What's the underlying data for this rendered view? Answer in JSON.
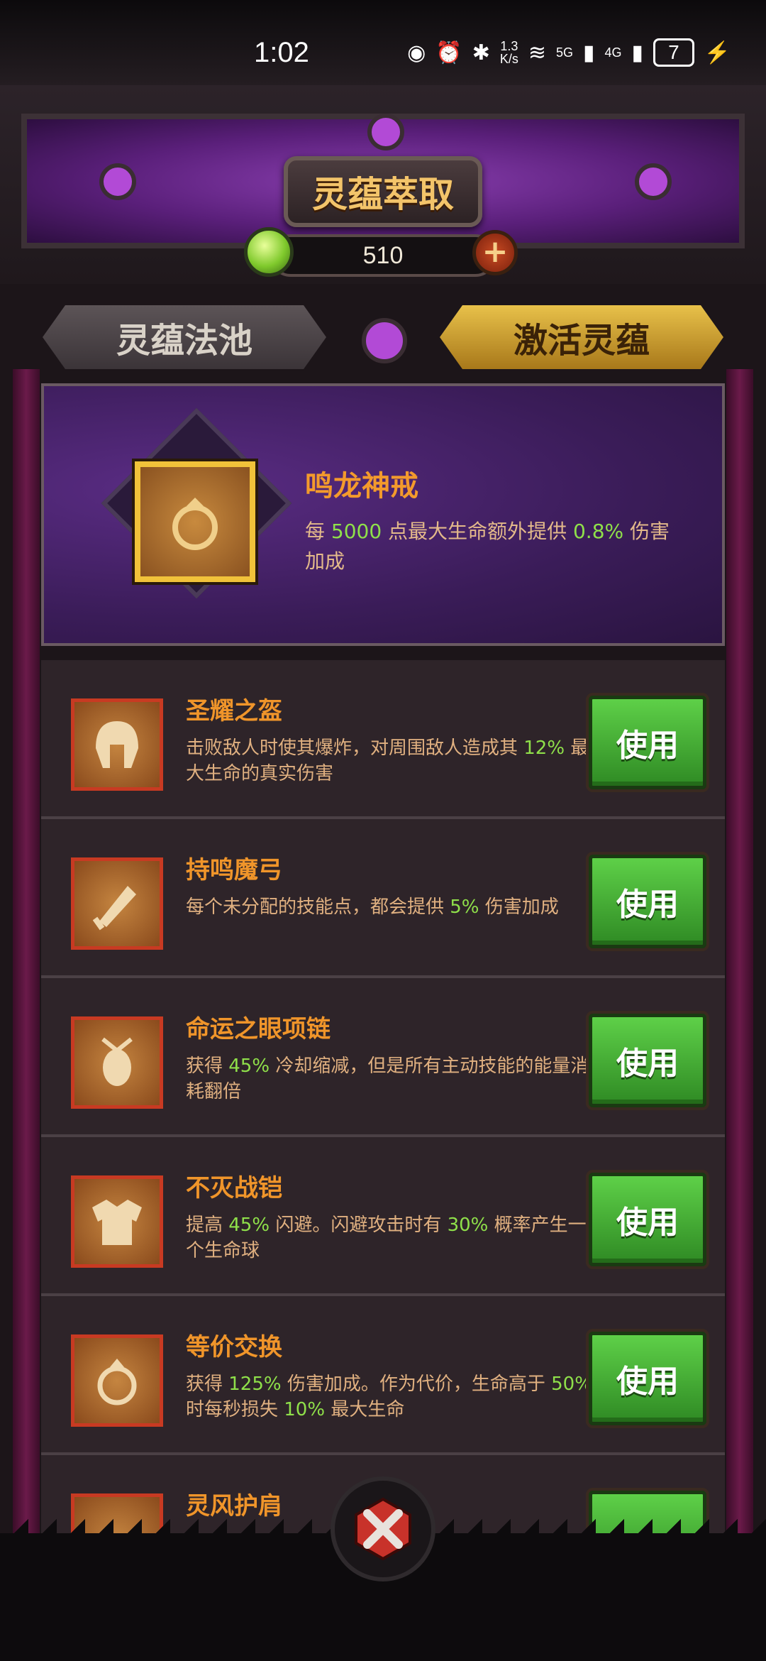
{
  "status_bar": {
    "time": "1:02",
    "net_speed": "1.3",
    "net_speed_unit": "K/s",
    "signal_5g": "5G",
    "signal_4g": "4G",
    "battery": "7"
  },
  "header": {
    "title": "灵蕴萃取",
    "currency_amount": "510"
  },
  "tabs": [
    {
      "label": "灵蕴法池",
      "active": false
    },
    {
      "label": "激活灵蕴",
      "active": true
    }
  ],
  "featured": {
    "name": "鸣龙神戒",
    "desc_parts": [
      "每 ",
      "5000",
      " 点最大生命额外提供 ",
      "0.8%",
      " 伤害加成"
    ]
  },
  "skills": [
    {
      "name": "圣耀之盔",
      "icon": "helmet-icon",
      "desc_parts": [
        "击败敌人时使其爆炸，对周围敌人造成其 ",
        "12%",
        " 最大生命的真实伤害"
      ],
      "button": "使用"
    },
    {
      "name": "持鸣魔弓",
      "icon": "bow-icon",
      "desc_parts": [
        "每个未分配的技能点，都会提供 ",
        "5%",
        " 伤害加成"
      ],
      "button": "使用"
    },
    {
      "name": "命运之眼项链",
      "icon": "amulet-icon",
      "desc_parts": [
        "获得 ",
        "45%",
        " 冷却缩减，但是所有主动技能的能量消耗翻倍"
      ],
      "button": "使用"
    },
    {
      "name": "不灭战铠",
      "icon": "armor-icon",
      "desc_parts": [
        "提高 ",
        "45%",
        " 闪避。闪避攻击时有 ",
        "30%",
        " 概率产生一个生命球"
      ],
      "button": "使用"
    },
    {
      "name": "等价交换",
      "icon": "ring-icon",
      "desc_parts": [
        "获得 ",
        "125%",
        " 伤害加成。作为代价，生命高于 ",
        "50%",
        " 时每秒损失 ",
        "10%",
        " 最大生命"
      ],
      "button": "使用"
    },
    {
      "name": "灵风护肩",
      "icon": "shoulder-icon",
      "desc_parts": [],
      "button": ""
    }
  ],
  "colors": {
    "accent_gold": "#f1c23a",
    "highlight_green": "#8fe04a",
    "name_orange": "#f0952a",
    "button_green": "#3fae2f"
  }
}
